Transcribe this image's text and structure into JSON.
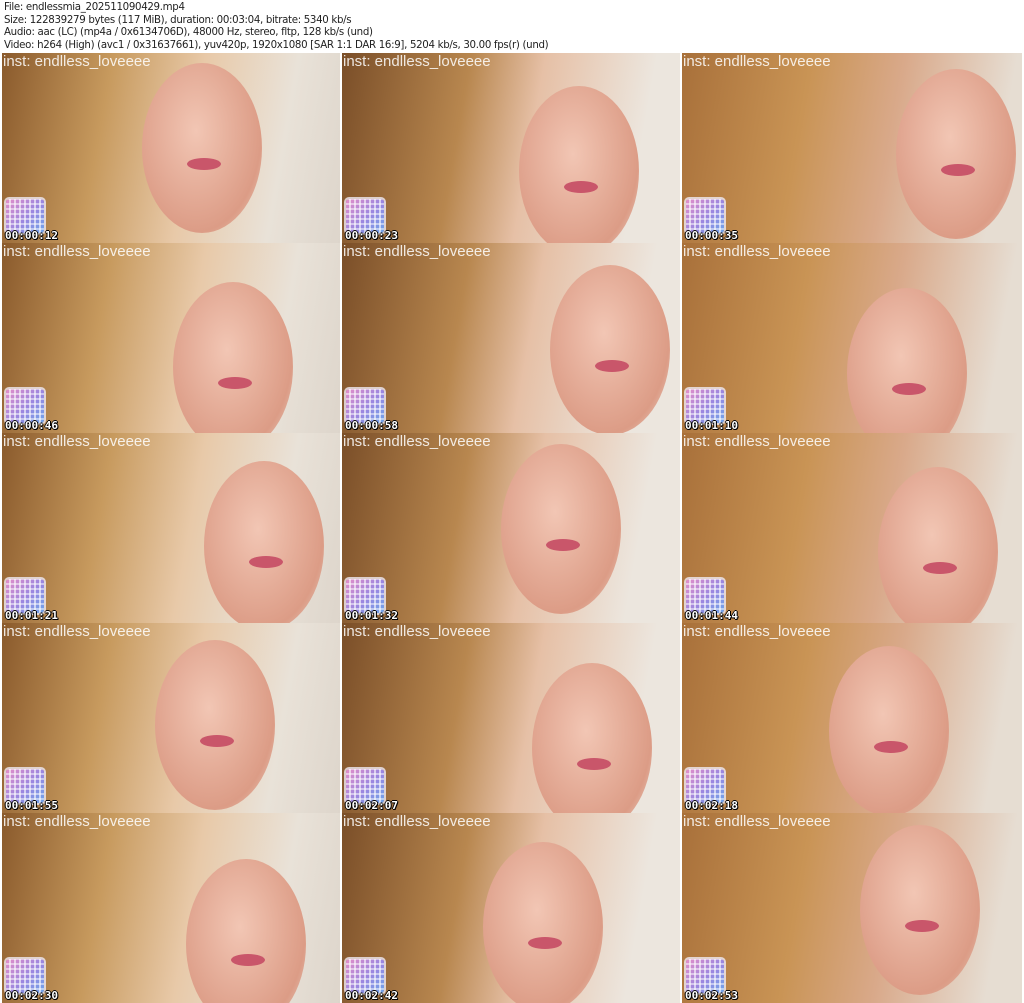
{
  "header": {
    "file_line": "File: endlessmia_202511090429.mp4",
    "size_line": "Size: 122839279 bytes (117 MiB), duration: 00:03:04, bitrate: 5340 kb/s",
    "audio_line": "Audio: aac (LC) (mp4a / 0x6134706D), 48000 Hz, stereo, fltp, 128 kb/s (und)",
    "video_line": "Video: h264 (High) (avc1 / 0x31637661), yuv420p, 1920x1080 [SAR 1:1 DAR 16:9], 5204 kb/s, 30.00 fps(r) (und)"
  },
  "watermark": "inst: endlless_loveeee",
  "thumbnails": [
    {
      "timestamp": "00:00:12"
    },
    {
      "timestamp": "00:00:23"
    },
    {
      "timestamp": "00:00:35"
    },
    {
      "timestamp": "00:00:46"
    },
    {
      "timestamp": "00:00:58"
    },
    {
      "timestamp": "00:01:10"
    },
    {
      "timestamp": "00:01:21"
    },
    {
      "timestamp": "00:01:32"
    },
    {
      "timestamp": "00:01:44"
    },
    {
      "timestamp": "00:01:55"
    },
    {
      "timestamp": "00:02:07"
    },
    {
      "timestamp": "00:02:18"
    },
    {
      "timestamp": "00:02:30"
    },
    {
      "timestamp": "00:02:42"
    },
    {
      "timestamp": "00:02:53"
    }
  ]
}
